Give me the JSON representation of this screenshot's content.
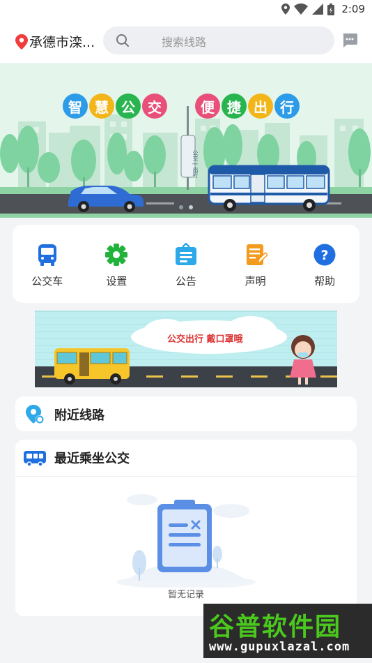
{
  "status_bar": {
    "time": "2:09"
  },
  "header": {
    "city": "承德市滦...",
    "search_placeholder": "搜索线路"
  },
  "banner": {
    "title_left": [
      "智",
      "慧",
      "公",
      "交"
    ],
    "title_right": [
      "便",
      "捷",
      "出",
      "行"
    ],
    "sign_text": "公交 | 出行",
    "colors_left": [
      "#2c9be8",
      "#f2b51a",
      "#28b44e",
      "#e8507a"
    ],
    "colors_right": [
      "#e8507a",
      "#28b44e",
      "#f2b51a",
      "#2c9be8"
    ]
  },
  "features": [
    {
      "label": "公交车",
      "icon": "bus-icon",
      "color": "#1f6fe0"
    },
    {
      "label": "设置",
      "icon": "gear-icon",
      "color": "#22b33c"
    },
    {
      "label": "公告",
      "icon": "notice-icon",
      "color": "#2da8e8"
    },
    {
      "label": "声明",
      "icon": "statement-icon",
      "color": "#f29b1d"
    },
    {
      "label": "帮助",
      "icon": "help-icon",
      "color": "#1f6fe0"
    }
  ],
  "promo": {
    "text": "公交出行  戴口罩哦"
  },
  "nearby": {
    "title": "附近线路"
  },
  "recent": {
    "title": "最近乘坐公交",
    "empty_text": "暂无记录"
  },
  "watermark": {
    "logo": "谷普软件园",
    "url": "www.gupuxlazal.com"
  }
}
